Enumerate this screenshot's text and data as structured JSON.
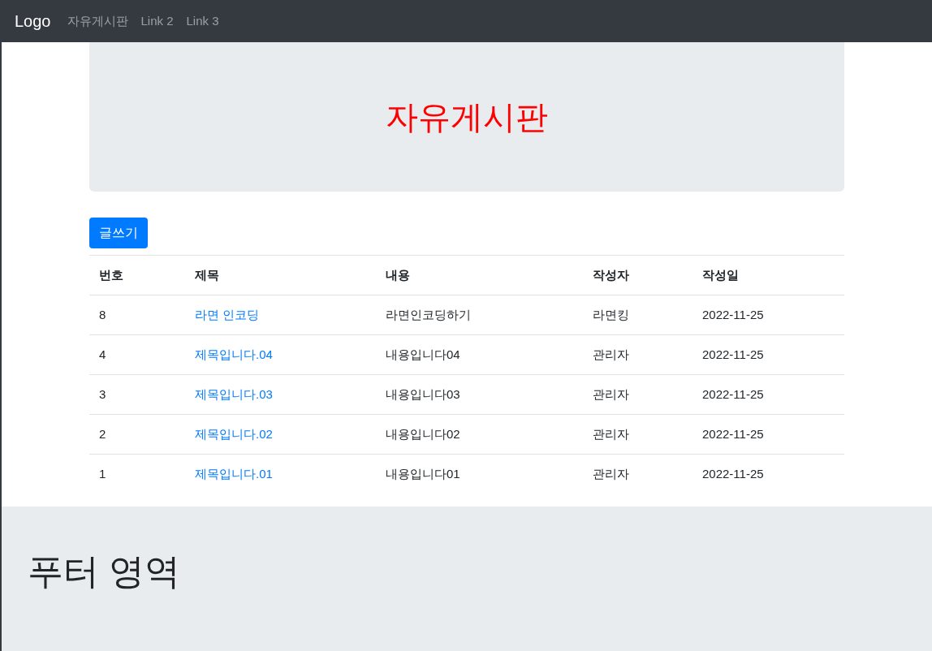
{
  "navbar": {
    "brand": "Logo",
    "links": [
      {
        "label": "자유게시판"
      },
      {
        "label": "Link 2"
      },
      {
        "label": "Link 3"
      }
    ]
  },
  "header": {
    "title": "자유게시판"
  },
  "write_button": "글쓰기",
  "table": {
    "columns": [
      "번호",
      "제목",
      "내용",
      "작성자",
      "작성일"
    ],
    "rows": [
      {
        "number": "8",
        "title": "라면 인코딩",
        "content": "라면인코딩하기",
        "author": "라면킹",
        "date": "2022-11-25"
      },
      {
        "number": "4",
        "title": "제목입니다.04",
        "content": "내용입니다04",
        "author": "관리자",
        "date": "2022-11-25"
      },
      {
        "number": "3",
        "title": "제목입니다.03",
        "content": "내용입니다03",
        "author": "관리자",
        "date": "2022-11-25"
      },
      {
        "number": "2",
        "title": "제목입니다.02",
        "content": "내용입니다02",
        "author": "관리자",
        "date": "2022-11-25"
      },
      {
        "number": "1",
        "title": "제목입니다.01",
        "content": "내용입니다01",
        "author": "관리자",
        "date": "2022-11-25"
      }
    ]
  },
  "footer": {
    "text": "푸터 영역"
  }
}
